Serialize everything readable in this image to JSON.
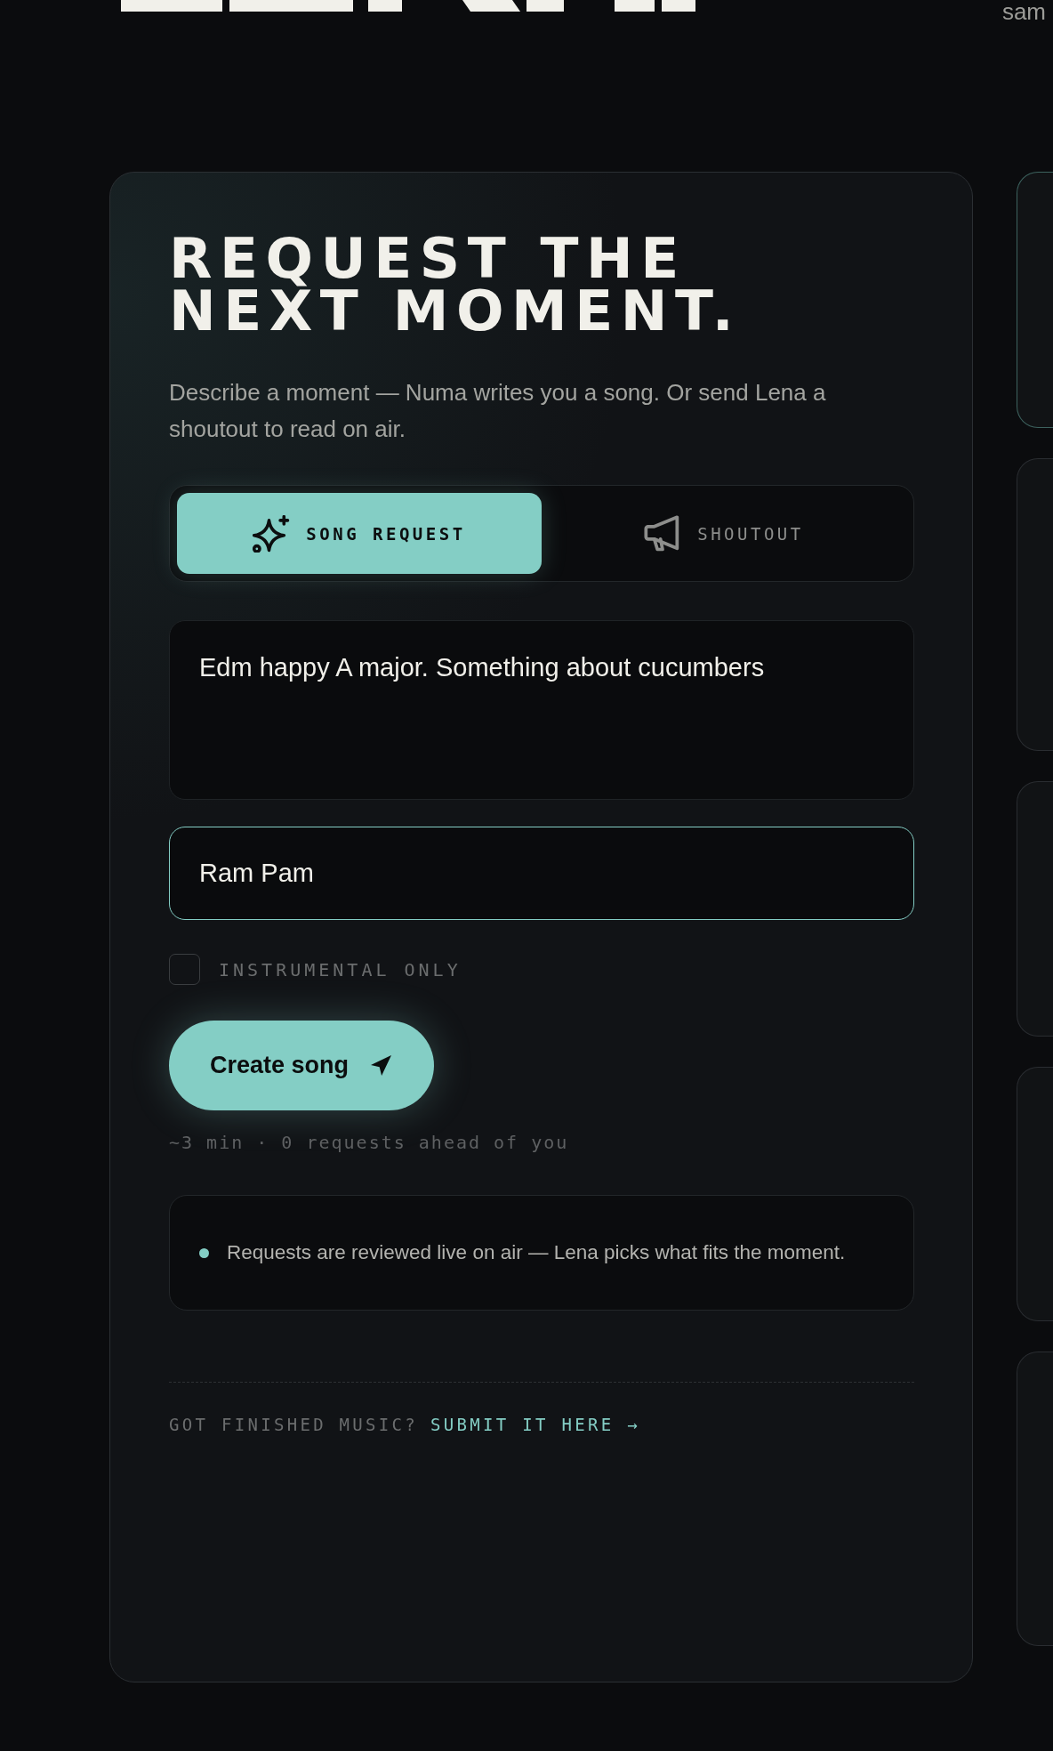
{
  "header": {
    "top_right_text": "sam"
  },
  "request_card": {
    "title": "REQUEST THE NEXT MOMENT.",
    "subtitle": "Describe a moment — Numa writes you a song. Or send Lena a shoutout to read on air.",
    "tabs": [
      {
        "label": "SONG REQUEST",
        "kind": "song",
        "selected": true
      },
      {
        "label": "SHOUTOUT",
        "kind": "shoutout",
        "selected": false
      }
    ],
    "prompt_field": {
      "value": "Edm happy A major. Something about cucumbers"
    },
    "name_field": {
      "value": "Ram Pam",
      "focused": true
    },
    "instrumental_checkbox": {
      "label": "INSTRUMENTAL ONLY",
      "checked": false
    },
    "create_button": {
      "label": "Create song"
    },
    "queue_info": "~3 min · 0 requests ahead of you",
    "notice": {
      "text": "Requests are reviewed live on air — Lena picks what fits the moment."
    },
    "footer": {
      "prompt": "GOT FINISHED MUSIC?",
      "link": "SUBMIT IT HERE →"
    }
  },
  "side_cards": [
    {
      "selected": true
    },
    {
      "selected": false
    },
    {
      "selected": false
    },
    {
      "selected": false
    },
    {
      "selected": false
    }
  ]
}
